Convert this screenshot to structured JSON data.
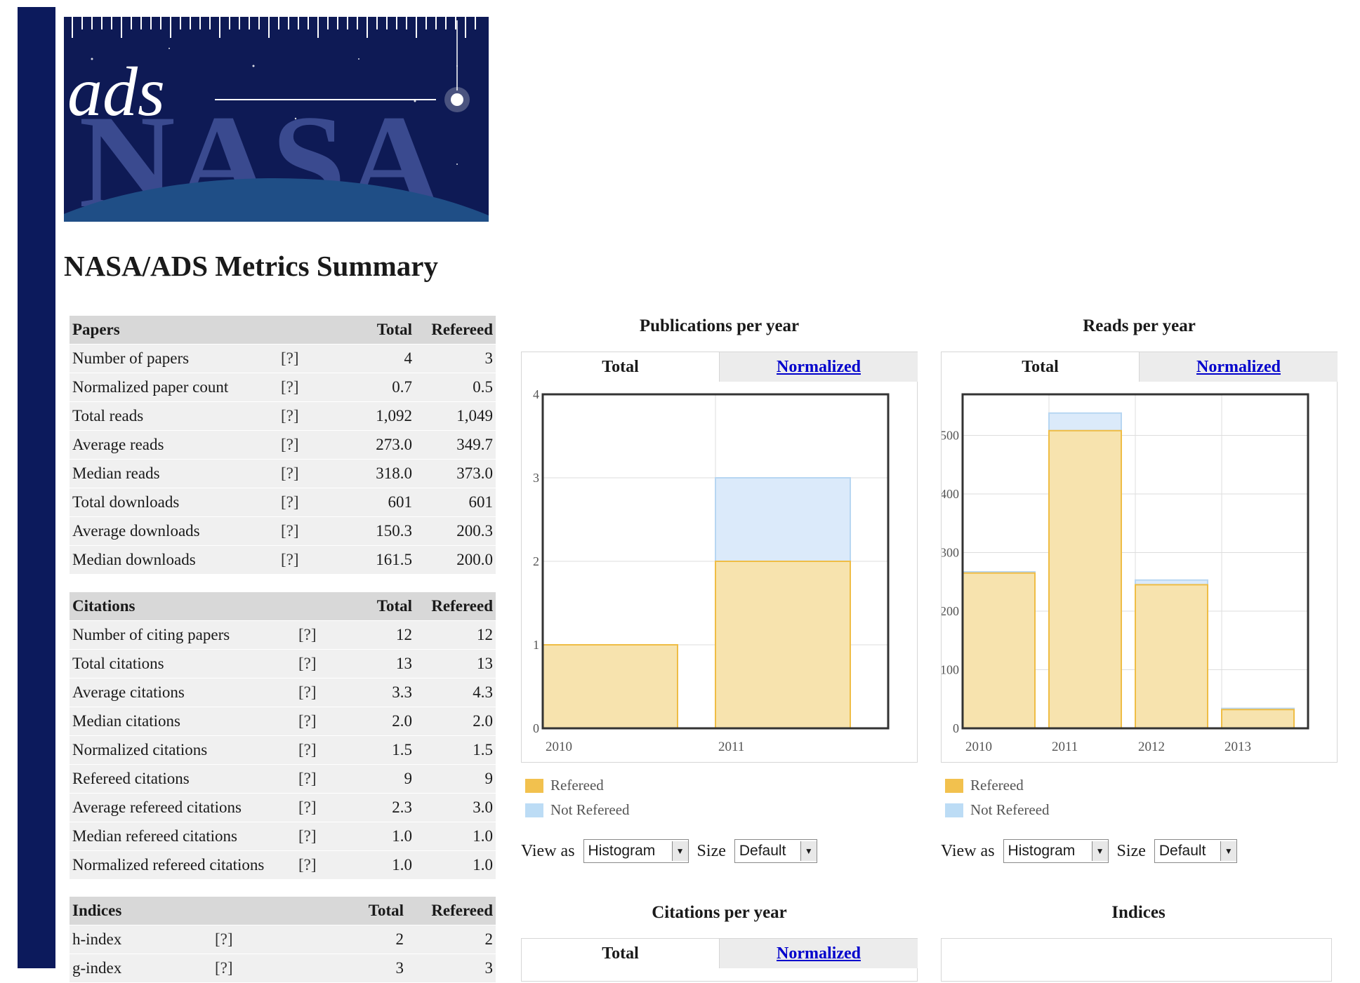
{
  "logo": {
    "text_ads": "ads",
    "text_nasa": "NASA"
  },
  "page_title": "NASA/ADS Metrics Summary",
  "papers_table": {
    "headers": [
      "Papers",
      "Total",
      "Refereed"
    ],
    "rows": [
      {
        "label": "Number of papers",
        "help": "[?]",
        "total": "4",
        "refereed": "3"
      },
      {
        "label": "Normalized paper count",
        "help": "[?]",
        "total": "0.7",
        "refereed": "0.5"
      },
      {
        "label": "Total reads",
        "help": "[?]",
        "total": "1,092",
        "refereed": "1,049"
      },
      {
        "label": "Average reads",
        "help": "[?]",
        "total": "273.0",
        "refereed": "349.7"
      },
      {
        "label": "Median reads",
        "help": "[?]",
        "total": "318.0",
        "refereed": "373.0"
      },
      {
        "label": "Total downloads",
        "help": "[?]",
        "total": "601",
        "refereed": "601"
      },
      {
        "label": "Average downloads",
        "help": "[?]",
        "total": "150.3",
        "refereed": "200.3"
      },
      {
        "label": "Median downloads",
        "help": "[?]",
        "total": "161.5",
        "refereed": "200.0"
      }
    ]
  },
  "citations_table": {
    "headers": [
      "Citations",
      "Total",
      "Refereed"
    ],
    "rows": [
      {
        "label": "Number of citing papers",
        "help": "[?]",
        "total": "12",
        "refereed": "12"
      },
      {
        "label": "Total citations",
        "help": "[?]",
        "total": "13",
        "refereed": "13"
      },
      {
        "label": "Average citations",
        "help": "[?]",
        "total": "3.3",
        "refereed": "4.3"
      },
      {
        "label": "Median citations",
        "help": "[?]",
        "total": "2.0",
        "refereed": "2.0"
      },
      {
        "label": "Normalized citations",
        "help": "[?]",
        "total": "1.5",
        "refereed": "1.5"
      },
      {
        "label": "Refereed citations",
        "help": "[?]",
        "total": "9",
        "refereed": "9"
      },
      {
        "label": "Average refereed citations",
        "help": "[?]",
        "total": "2.3",
        "refereed": "3.0"
      },
      {
        "label": "Median refereed citations",
        "help": "[?]",
        "total": "1.0",
        "refereed": "1.0"
      },
      {
        "label": "Normalized refereed citations",
        "help": "[?]",
        "total": "1.0",
        "refereed": "1.0"
      }
    ]
  },
  "indices_table": {
    "headers": [
      "Indices",
      "Total",
      "Refereed"
    ],
    "rows": [
      {
        "label": "h-index",
        "help": "[?]",
        "total": "2",
        "refereed": "2"
      },
      {
        "label": "g-index",
        "help": "[?]",
        "total": "3",
        "refereed": "3"
      }
    ]
  },
  "colors": {
    "refereed": "#f2c14e",
    "not_refereed": "#bcdcf5",
    "link": "#0000cc",
    "sidebar": "#0c1a5c"
  },
  "chart_data": [
    {
      "type": "bar",
      "title": "Publications per year",
      "categories": [
        "2010",
        "2011"
      ],
      "series": [
        {
          "name": "Refereed",
          "values": [
            1,
            2
          ]
        },
        {
          "name": "Not Refereed",
          "values": [
            0,
            1
          ]
        }
      ],
      "ylim": [
        0,
        4
      ],
      "yticks": [
        "0",
        "1",
        "2",
        "3",
        "4"
      ],
      "stacked": true,
      "grid": true
    },
    {
      "type": "bar",
      "title": "Reads per year",
      "categories": [
        "2010",
        "2011",
        "2012",
        "2013"
      ],
      "series": [
        {
          "name": "Refereed",
          "values": [
            265,
            508,
            245,
            32
          ]
        },
        {
          "name": "Not Refereed",
          "values": [
            2,
            30,
            8,
            2
          ]
        }
      ],
      "ylim": [
        0,
        570
      ],
      "yticks": [
        "0",
        "100",
        "200",
        "300",
        "400",
        "500"
      ],
      "stacked": true,
      "grid": true
    }
  ],
  "chart_panels": {
    "pubs": {
      "title": "Publications per year",
      "tab_total": "Total",
      "tab_normalized": "Normalized"
    },
    "reads": {
      "title": "Reads per year",
      "tab_total": "Total",
      "tab_normalized": "Normalized"
    },
    "citations": {
      "title": "Citations per year",
      "tab_total": "Total",
      "tab_normalized": "Normalized"
    },
    "indices": {
      "title": "Indices"
    }
  },
  "legend": {
    "refereed": "Refereed",
    "not_refereed": "Not Refereed"
  },
  "controls": {
    "view_as_label": "View as",
    "view_as_value": "Histogram",
    "size_label": "Size",
    "size_value": "Default"
  }
}
